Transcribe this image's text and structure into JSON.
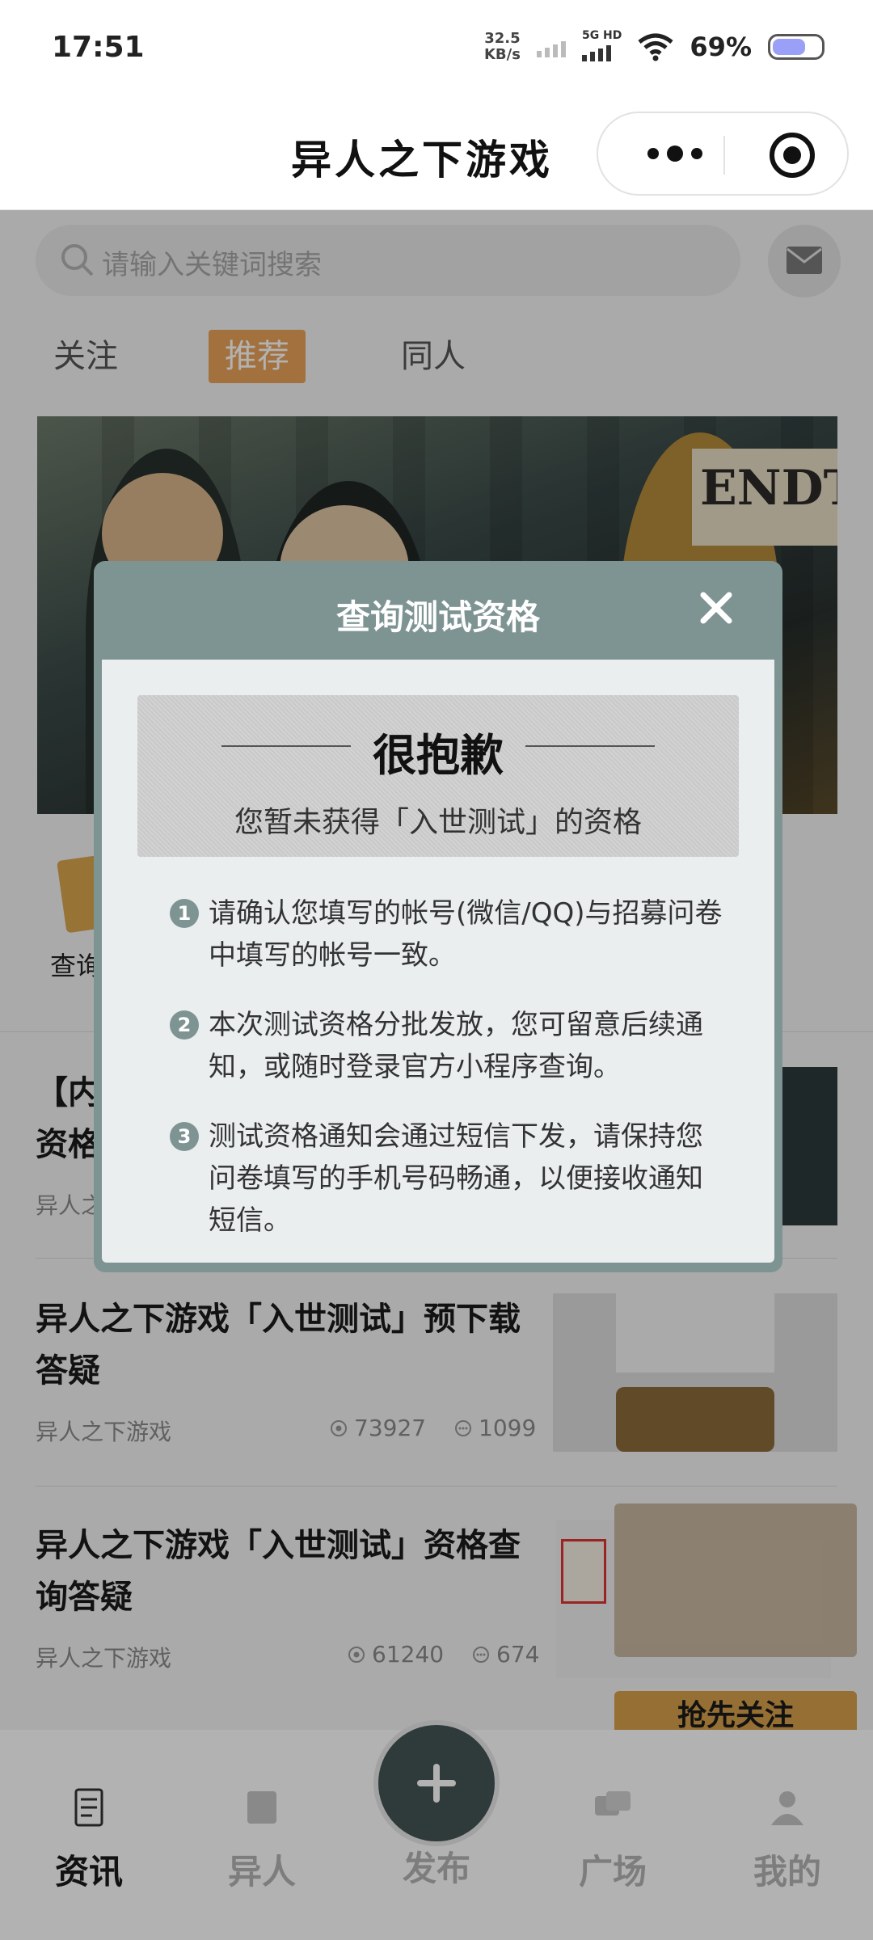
{
  "status_bar": {
    "time": "17:51",
    "net_speed_value": "32.5",
    "net_speed_unit": "KB/s",
    "network_label": "5G HD",
    "battery_percent": "69%",
    "battery_level": 0.69
  },
  "title_bar": {
    "title": "异人之下游戏"
  },
  "search": {
    "placeholder": "请输入关键词搜索"
  },
  "tabs": [
    {
      "label": "关注"
    },
    {
      "label": "推荐",
      "active": true
    },
    {
      "label": "同人"
    }
  ],
  "banner": {
    "sign_text": "ENDT"
  },
  "quick_entry": {
    "label": "查询"
  },
  "articles": [
    {
      "title": "异人之下游戏「入世测试」预下载答疑",
      "source": "异人之下游戏",
      "views": "73927",
      "comments": "1099"
    },
    {
      "title": "异人之下游戏「入世测试」资格查询答疑",
      "source": "异人之下游戏",
      "views": "61240",
      "comments": "674"
    }
  ],
  "partial_article": {
    "title_line1": "【内",
    "title_line2": "资格",
    "source": "异人之"
  },
  "floating_card": {
    "label": "抢先关注"
  },
  "bottom_nav": [
    {
      "label": "资讯",
      "icon": "news-icon",
      "active": true
    },
    {
      "label": "异人",
      "icon": "scroll-icon"
    },
    {
      "label": "发布",
      "icon": "plus-icon"
    },
    {
      "label": "广场",
      "icon": "chat-icon"
    },
    {
      "label": "我的",
      "icon": "user-icon"
    }
  ],
  "modal": {
    "title": "查询测试资格",
    "close_icon": "close-icon",
    "sorry_title": "很抱歉",
    "sorry_subtitle": "您暂未获得「入世测试」的资格",
    "items": [
      {
        "num": "1",
        "text": "请确认您填写的帐号(微信/QQ)与招募问卷中填写的帐号一致。"
      },
      {
        "num": "2",
        "text": "本次测试资格分批发放，您可留意后续通知，或随时登录官方小程序查询。"
      },
      {
        "num": "3",
        "text": "测试资格通知会通过短信下发，请保持您问卷填写的手机号码畅通，以便接收通知短信。"
      }
    ]
  },
  "colors": {
    "accent": "#e8a25a",
    "modal_frame": "#7e9493",
    "modal_body": "#eaeeef"
  }
}
